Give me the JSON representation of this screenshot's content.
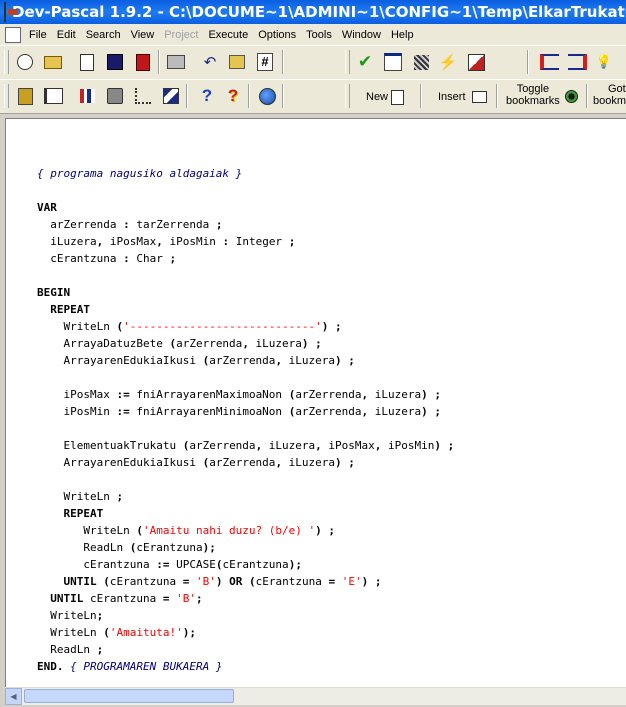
{
  "window": {
    "title": "Dev-Pascal 1.9.2 - C:\\DOCUME~1\\ADMINI~1\\CONFIG~1\\Temp\\ElkarTrukatu"
  },
  "menu": {
    "items": [
      {
        "label": "File",
        "enabled": true
      },
      {
        "label": "Edit",
        "enabled": true
      },
      {
        "label": "Search",
        "enabled": true
      },
      {
        "label": "View",
        "enabled": true
      },
      {
        "label": "Project",
        "enabled": false
      },
      {
        "label": "Execute",
        "enabled": true
      },
      {
        "label": "Options",
        "enabled": true
      },
      {
        "label": "Tools",
        "enabled": true
      },
      {
        "label": "Window",
        "enabled": true
      },
      {
        "label": "Help",
        "enabled": true
      }
    ]
  },
  "toolbar2": {
    "new_label": "New",
    "insert_label": "Insert",
    "toggle_bookmarks_line1": "Toggle",
    "toggle_bookmarks_line2": "bookmarks",
    "goto_bookmarks_line1": "Goto",
    "goto_bookmarks_line2": "bookmarks"
  },
  "toolbar_glyphs": {
    "help": "?",
    "context_help": "?",
    "check": "✔",
    "lightning": "⚡",
    "bulb": "💡",
    "undo": "↶",
    "grid": "#"
  },
  "colors": {
    "keyword": "#000000",
    "comment": "#00007f",
    "string": "#ff0000",
    "titlebar": "#0a5ee0",
    "editor_bg": "#ffffff"
  },
  "code": [
    "",
    "{ programa nagusiko aldagaiak }",
    "",
    "VAR",
    "  arZerrenda : tarZerrenda ;",
    "  iLuzera, iPosMax, iPosMin : Integer ;",
    "  cErantzuna : Char ;",
    "",
    "BEGIN",
    "  REPEAT",
    "    WriteLn ('----------------------------') ;",
    "    ArrayaDatuzBete (arZerrenda, iLuzera) ;",
    "    ArrayarenEdukiaIkusi (arZerrenda, iLuzera) ;",
    "",
    "    iPosMax := fniArrayarenMaximoaNon (arZerrenda, iLuzera) ;",
    "    iPosMin := fniArrayarenMinimoaNon (arZerrenda, iLuzera) ;",
    "",
    "    ElementuakTrukatu (arZerrenda, iLuzera, iPosMax, iPosMin) ;",
    "    ArrayarenEdukiaIkusi (arZerrenda, iLuzera) ;",
    "",
    "    WriteLn ;",
    "    REPEAT",
    "       WriteLn ('Amaitu nahi duzu? (b/e) ') ;",
    "       ReadLn (cErantzuna);",
    "       cErantzuna := UPCASE(cErantzuna);",
    "    UNTIL (cErantzuna = 'B') OR (cErantzuna = 'E') ;",
    "  UNTIL cErantzuna = 'B';",
    "  WriteLn;",
    "  WriteLn ('Amaituta!');",
    "  ReadLn ;",
    "END. { PROGRAMAREN BUKAERA }"
  ],
  "scrollbar": {
    "left_arrow": "◀"
  }
}
